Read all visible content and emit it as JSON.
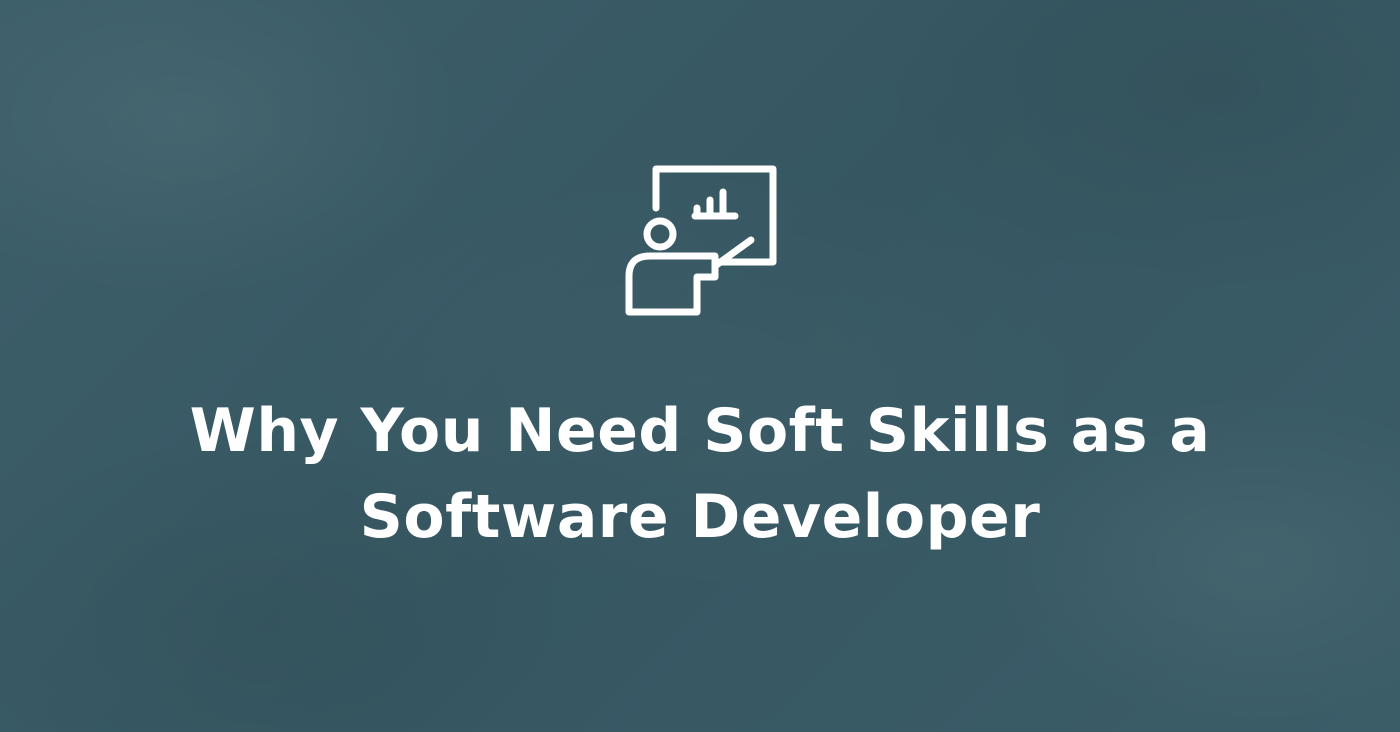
{
  "banner": {
    "background_color": "#3a5c67",
    "icon": "presentation-board-icon",
    "title_lines": [
      "Why You Need Soft Skills as a",
      "Software Developer"
    ]
  }
}
